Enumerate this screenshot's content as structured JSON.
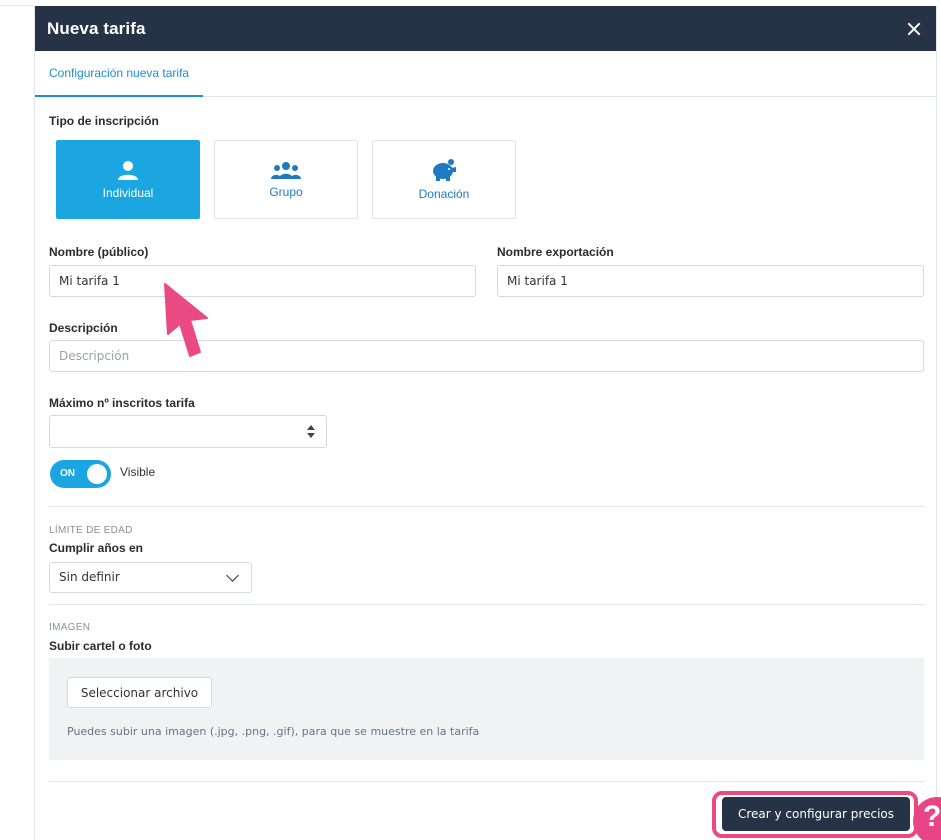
{
  "modal": {
    "title": "Nueva tarifa",
    "tab": "Configuración nueva tarifa"
  },
  "form": {
    "tipo_label": "Tipo de inscripción",
    "types": [
      {
        "label": "Individual",
        "icon": "person-icon",
        "active": true
      },
      {
        "label": "Grupo",
        "icon": "group-icon",
        "active": false
      },
      {
        "label": "Donación",
        "icon": "piggy-bank-icon",
        "active": false
      }
    ],
    "nombre_label": "Nombre (público)",
    "nombre_value": "Mi tarifa 1",
    "export_label": "Nombre exportación",
    "export_value": "Mi tarifa 1",
    "desc_label": "Descripción",
    "desc_placeholder": "Descripción",
    "max_label": "Máximo nº inscritos tarifa",
    "max_value": "",
    "toggle_text": "ON",
    "toggle_on": true,
    "visible_label": "Visible"
  },
  "edad": {
    "section": "LÍMITE DE EDAD",
    "label": "Cumplir años en",
    "selected": "Sin definir"
  },
  "imagen": {
    "section": "IMAGEN",
    "label": "Subir cartel o foto",
    "button": "Seleccionar archivo",
    "hint": "Puedes subir una imagen (.jpg, .png, .gif), para que se muestre en la tarifa"
  },
  "footer": {
    "primary_button": "Crear y configurar precios"
  },
  "help": {
    "glyph": "?"
  },
  "colors": {
    "header": "#263246",
    "accent": "#1ba6e2",
    "highlight": "#ea4a82"
  }
}
